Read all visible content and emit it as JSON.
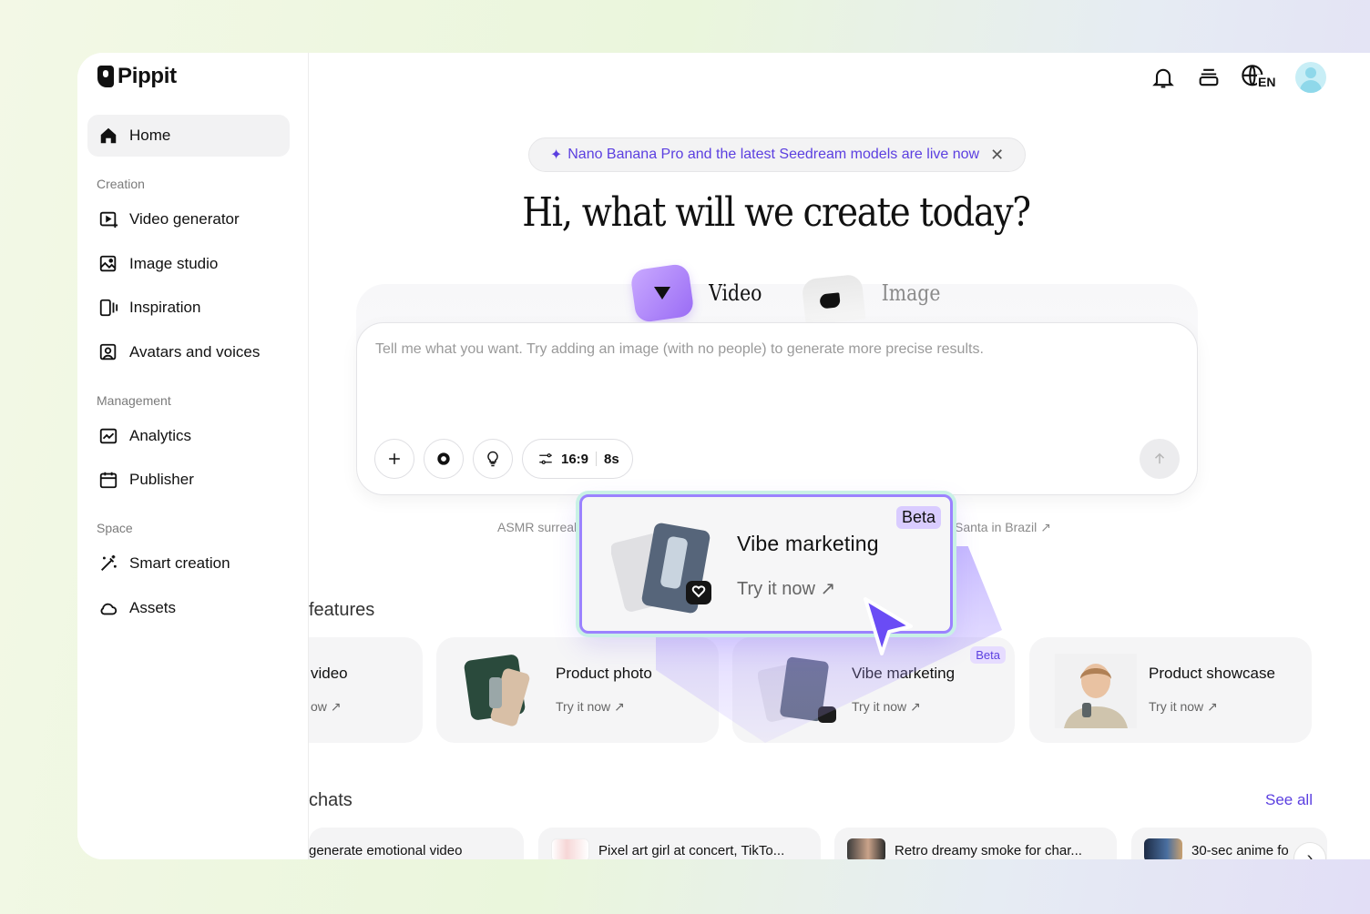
{
  "app": {
    "name": "Pippit"
  },
  "sidebar": {
    "home": "Home",
    "sections": {
      "creation": "Creation",
      "management": "Management",
      "space": "Space"
    },
    "items": {
      "video_generator": "Video generator",
      "image_studio": "Image studio",
      "inspiration": "Inspiration",
      "avatars": "Avatars and voices",
      "analytics": "Analytics",
      "publisher": "Publisher",
      "smart_creation": "Smart creation",
      "assets": "Assets"
    }
  },
  "topbar": {
    "lang": "EN"
  },
  "banner": {
    "text": "Nano Banana Pro and the latest Seedream models are live now",
    "close": "✕"
  },
  "headline": "Hi, what will we create today?",
  "modes": {
    "video": "Video",
    "image": "Image"
  },
  "prompt": {
    "placeholder": "Tell me what you want. Try adding an image (with no people) to generate more precise results.",
    "ratio": "16:9",
    "duration": "8s"
  },
  "suggestions": {
    "left": "ASMR surreal",
    "right": "Santa in Brazil ↗"
  },
  "features": {
    "title": "features",
    "cards": [
      {
        "title": "video",
        "try": "ow ↗"
      },
      {
        "title": "Product photo",
        "try": "Try it now ↗"
      },
      {
        "title": "Vibe marketing",
        "try": "Try it now ↗",
        "badge": "Beta"
      },
      {
        "title": "Product showcase",
        "try": "Try it now ↗"
      }
    ]
  },
  "popup": {
    "title": "Vibe marketing",
    "try": "Try it now ↗",
    "badge": "Beta"
  },
  "chats": {
    "title": "chats",
    "see_all": "See all",
    "items": [
      "generate emotional video",
      "Pixel art girl at concert, TikTo...",
      "Retro dreamy smoke for char...",
      "30-sec anime fo"
    ]
  },
  "colors": {
    "accent": "#5b3fe0",
    "popup_border": "#9b82ff"
  }
}
